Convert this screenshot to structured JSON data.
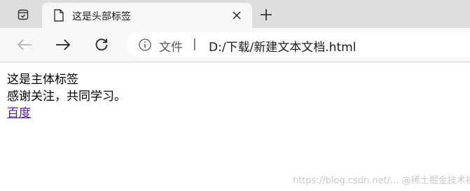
{
  "tab": {
    "title": "这是头部标签"
  },
  "address": {
    "site_label": "文件",
    "separator": "|",
    "url": "D:/下载/新建文本文档.html"
  },
  "page": {
    "heading_text": "这是主体标签",
    "body_text": "感谢关注，共同学习。",
    "link_text": "百度"
  },
  "watermark": "https://blog.csdn.net/... @稀土掘金技术社区",
  "icons": {
    "tab_actions": "tab-actions-icon",
    "favicon": "document-icon",
    "close": "close-icon",
    "new_tab": "plus-icon",
    "back": "arrow-left-icon",
    "forward": "arrow-right-icon",
    "refresh": "refresh-icon",
    "info": "info-icon"
  },
  "colors": {
    "tab_strip": "#dedede",
    "toolbar": "#f7f7f7",
    "link_visited": "#551a8b"
  }
}
